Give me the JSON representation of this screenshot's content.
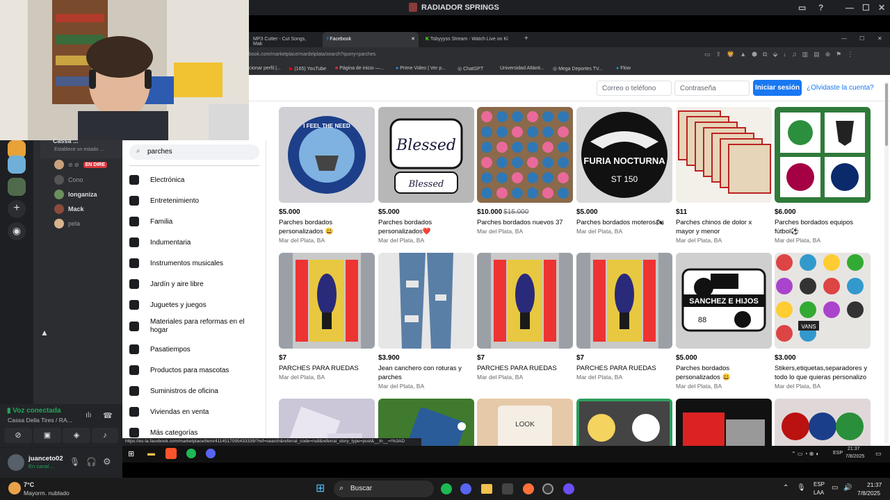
{
  "discord": {
    "window_title": "RADIADOR SPRINGS",
    "server_banner": "Cassa ...",
    "status_placeholder": "Establece un estado ...",
    "live_badge": "EN DIRE",
    "voice_users": [
      "Cono",
      "longaniza",
      "Mack",
      "pela"
    ],
    "voice_status": "Voz conectada",
    "voice_channel": "Cassa Della Tires / RA...",
    "username": "juanceto02",
    "user_status": "En canal ..."
  },
  "browser": {
    "tabs": [
      {
        "label": "MP3 Cutter - Cut Songs, Mak",
        "active": false
      },
      {
        "label": "Facebook",
        "active": true
      },
      {
        "label": "Tobyyyss Stream - Watch Live on Ki",
        "active": false
      }
    ],
    "url": "book.com/marketplace/mardelplata/search?query=parches",
    "bookmarks": [
      "cionar perfil |...",
      "(165) YouTube",
      "Página de inicio —...",
      "Prime Video | Ver p...",
      "ChatGPT",
      "Universidad Atlánti...",
      "Mega Deportes TV...",
      "Flow"
    ],
    "status_url": "https://es-la.facebook.com/marketplace/item/4114517095433339/?ref=search&referral_code=null&referral_story_type=post&__tn__=!%3AD"
  },
  "facebook": {
    "email_placeholder": "Correo o teléfono",
    "password_placeholder": "Contraseña",
    "login_button": "Iniciar sesión",
    "forgot_link": "¿Olvidaste la cuenta?",
    "search_value": "parches",
    "categories": [
      "Electrónica",
      "Entretenimiento",
      "Familia",
      "Indumentaria",
      "Instrumentos musicales",
      "Jardín y aire libre",
      "Juguetes y juegos",
      "Materiales para reformas en el hogar",
      "Pasatiempos",
      "Productos para mascotas",
      "Suministros de oficina",
      "Viviendas en venta",
      "Más categorías"
    ],
    "listings_row1": [
      {
        "price": "$5.000",
        "old_price": "",
        "title": "Parches bordados personalizados 😃",
        "location": "Mar del Plata, BA"
      },
      {
        "price": "$5.000",
        "old_price": "",
        "title": "Parches bordados personalizados❤️",
        "location": "Mar del Plata, BA"
      },
      {
        "price": "$10.000",
        "old_price": "$15.000",
        "title": "Parches bordados nuevos 37",
        "location": "Mar del Plata, BA"
      },
      {
        "price": "$5.000",
        "old_price": "",
        "title": "Parches bordados moteros🏍",
        "location": "Mar del Plata, BA"
      },
      {
        "price": "$11",
        "old_price": "",
        "title": "Parches chinos de dolor x mayor y menor",
        "location": "Mar del Plata, BA"
      },
      {
        "price": "$6.000",
        "old_price": "",
        "title": "Parches bordados equipos fútbol⚽",
        "location": "Mar del Plata, BA"
      }
    ],
    "listings_row2": [
      {
        "price": "$7",
        "old_price": "",
        "title": "PARCHES PARA RUEDAS",
        "location": "Mar del Plata, BA"
      },
      {
        "price": "$3.900",
        "old_price": "",
        "title": "Jean canchero con roturas y parches",
        "location": "Mar del Plata, BA"
      },
      {
        "price": "$7",
        "old_price": "",
        "title": "PARCHES PARA RUEDAS",
        "location": "Mar del Plata, BA"
      },
      {
        "price": "$7",
        "old_price": "",
        "title": "PARCHES PARA RUEDAS",
        "location": "Mar del Plata, BA"
      },
      {
        "price": "$5.000",
        "old_price": "",
        "title": "Parches bordados personalizados 😃",
        "location": "Mar del Plata, BA"
      },
      {
        "price": "$3.000",
        "old_price": "",
        "title": "Stikers,etiquetas,separadores y todo lo que quieras personalizo",
        "location": "Mar del Plata, BA"
      }
    ],
    "patch_texts": {
      "p1": "I FEEL THE NEED",
      "p2": "Blessed",
      "p4a": "FURIA NOCTURNA",
      "p4b": "ST 150",
      "p11": "SANCHEZ E HIJOS",
      "p11b": "88",
      "p12": "VANS",
      "p15": "LOOK"
    }
  },
  "inner_taskbar": {
    "lang": "ESP",
    "time": "21:37",
    "date": "7/8/2025"
  },
  "taskbar": {
    "weather_temp": "7°C",
    "weather_desc": "Mayorm. nublado",
    "search_label": "Buscar",
    "lang": "ESP",
    "lang2": "LAA",
    "time": "21:37",
    "date": "7/8/2025"
  }
}
